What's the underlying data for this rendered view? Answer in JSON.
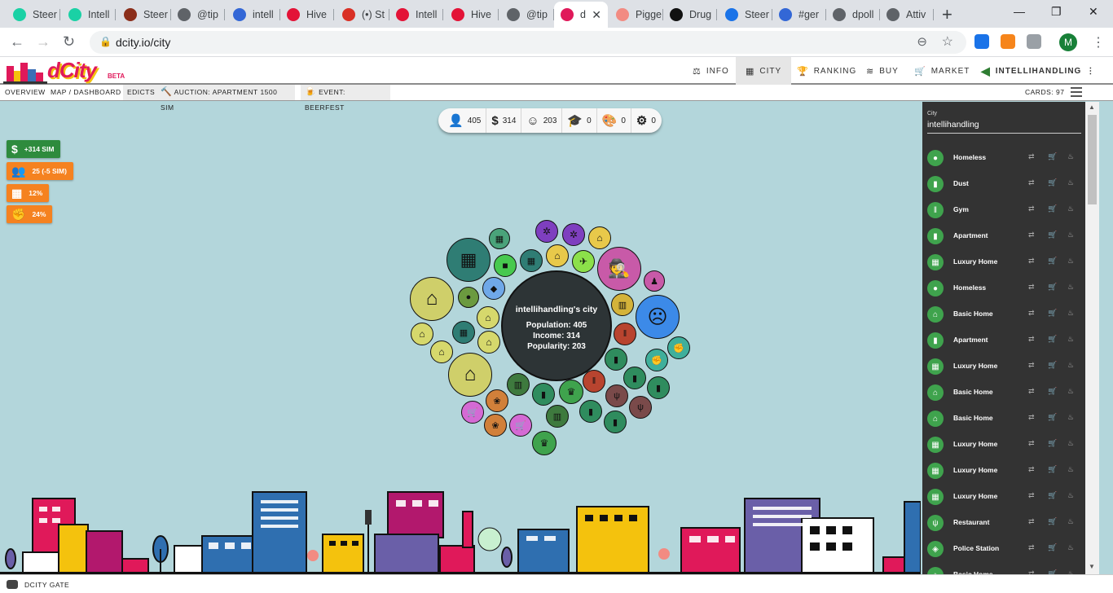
{
  "browser": {
    "tabs": [
      {
        "label": "Steer",
        "color": "#1ad1a5"
      },
      {
        "label": "Intell",
        "color": "#1ad1a5"
      },
      {
        "label": "Steer",
        "color": "#8b2e1a"
      },
      {
        "label": "@tip",
        "color": "#5f6368"
      },
      {
        "label": "intell",
        "color": "#3367d6"
      },
      {
        "label": "Hive",
        "color": "#e31337"
      },
      {
        "label": "(•) St",
        "color": "#d93025"
      },
      {
        "label": "Intell",
        "color": "#e31337"
      },
      {
        "label": "Hive",
        "color": "#e31337"
      },
      {
        "label": "@tip",
        "color": "#5f6368"
      },
      {
        "label": "d",
        "color": "#e0195a",
        "active": true
      },
      {
        "label": "Pigge",
        "color": "#f28b82"
      },
      {
        "label": "Drug",
        "color": "#111111"
      },
      {
        "label": "Steer",
        "color": "#1a73e8"
      },
      {
        "label": "#ger",
        "color": "#3367d6"
      },
      {
        "label": "dpoll",
        "color": "#5f6368"
      },
      {
        "label": "Attiv",
        "color": "#5f6368"
      }
    ],
    "url": "dcity.io/city",
    "profile_initial": "M"
  },
  "header": {
    "logo_text": "dCity",
    "beta_label": "BETA",
    "nav": [
      {
        "label": "INFO",
        "icon": "scale-icon"
      },
      {
        "label": "CITY",
        "icon": "building-icon",
        "active": true
      },
      {
        "label": "RANKING",
        "icon": "trophy-icon"
      },
      {
        "label": "BUY",
        "icon": "coins-icon"
      },
      {
        "label": "MARKET",
        "icon": "cart-icon"
      }
    ],
    "user": "INTELLIHANDLING"
  },
  "subnav": {
    "items": [
      "OVERVIEW",
      "MAP / DASHBOARD",
      "EDICTS"
    ],
    "auction": "AUCTION: APARTMENT 1500 SIM",
    "event": "EVENT: BEERFEST",
    "cards": "CARDS: 97"
  },
  "stats": [
    {
      "icon": "person-icon",
      "value": "405"
    },
    {
      "icon": "dollar-icon",
      "value": "314"
    },
    {
      "icon": "smile-icon",
      "value": "203"
    },
    {
      "icon": "graduation-icon",
      "value": "0"
    },
    {
      "icon": "palette-icon",
      "value": "0"
    },
    {
      "icon": "gear-icon",
      "value": "0"
    }
  ],
  "badges": [
    {
      "label": "+314 SIM",
      "color": "#2e8b3d",
      "icon": "dollar-icon"
    },
    {
      "label": "25 (-5 SIM)",
      "color": "#f58220",
      "icon": "users-icon"
    },
    {
      "label": "12%",
      "color": "#f58220",
      "icon": "building-icon"
    },
    {
      "label": "24%",
      "color": "#f58220",
      "icon": "fist-icon"
    }
  ],
  "city": {
    "name": "intellihandling's city",
    "population": "Population: 405",
    "income": "Income: 314",
    "popularity": "Popularity: 203"
  },
  "panel": {
    "label": "City",
    "value": "intellihandling",
    "items": [
      "Homeless",
      "Dust",
      "Gym",
      "Apartment",
      "Luxury Home",
      "Homeless",
      "Basic Home",
      "Apartment",
      "Luxury Home",
      "Basic Home",
      "Basic Home",
      "Luxury Home",
      "Luxury Home",
      "Luxury Home",
      "Restaurant",
      "Police Station",
      "Basic Home"
    ]
  },
  "footer": {
    "label": "DCITY GATE"
  },
  "colors": {
    "accent": "#e0195a",
    "panel_green": "#3fa34d",
    "background": "#b3d6db"
  }
}
